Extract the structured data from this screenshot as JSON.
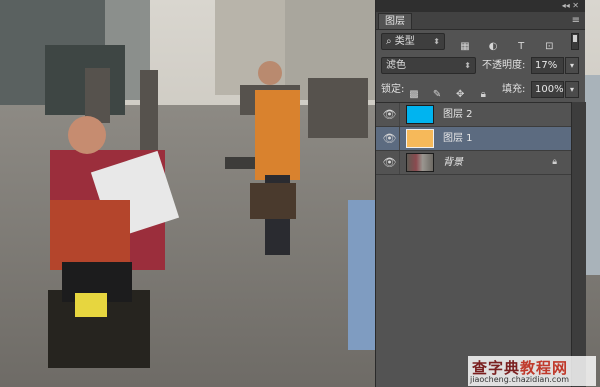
{
  "panel": {
    "collapse_icon": "double-arrow-icon",
    "tab_label": "图层",
    "filter": {
      "kind_label": "类型",
      "icons": [
        "image-icon",
        "adjustment-icon",
        "type-icon",
        "shape-icon",
        "smart-object-icon"
      ]
    },
    "blend_mode": "滤色",
    "opacity_label": "不透明度:",
    "opacity_value": "17%",
    "lock_label": "锁定:",
    "fill_label": "填充:",
    "fill_value": "100%",
    "layers": [
      {
        "name": "图层 2",
        "color": "#00b4f0",
        "visible": true,
        "selected": false,
        "locked": false
      },
      {
        "name": "图层 1",
        "color": "#f6b95a",
        "visible": true,
        "selected": true,
        "locked": false
      },
      {
        "name": "背景",
        "color": "photo",
        "visible": true,
        "selected": false,
        "locked": true
      }
    ]
  },
  "watermark": {
    "title_a": "查字典",
    "title_b": "教程网",
    "url": "jiaocheng.chazidian.com"
  }
}
